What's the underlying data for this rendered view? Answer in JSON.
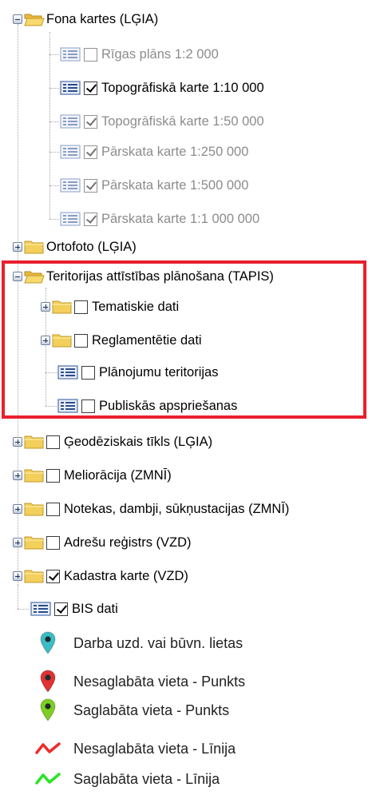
{
  "tree": {
    "fona": {
      "label": "Fona kartes (LĢIA)",
      "children": [
        {
          "label": "Rīgas plāns 1:2 000",
          "checked": false,
          "dimmed": true
        },
        {
          "label": "Topogrāfiskā karte 1:10 000",
          "checked": true,
          "dimmed": false
        },
        {
          "label": "Topogrāfiskā karte 1:50 000",
          "checked": true,
          "dimmed": true
        },
        {
          "label": "Pārskata karte 1:250 000",
          "checked": true,
          "dimmed": true
        },
        {
          "label": "Pārskata karte 1:500 000",
          "checked": true,
          "dimmed": true
        },
        {
          "label": "Pārskata karte 1:1 000 000",
          "checked": true,
          "dimmed": true
        }
      ]
    },
    "ortofoto": {
      "label": "Ortofoto (LĢIA)"
    },
    "tapis": {
      "label": "Teritorijas attīstības plānošana (TAPIS)",
      "children": [
        {
          "label": "Tematiskie dati",
          "type": "folder",
          "checked": false
        },
        {
          "label": "Reglamentētie dati",
          "type": "folder",
          "checked": false
        },
        {
          "label": "Plānojumu teritorijas",
          "type": "layer",
          "checked": false
        },
        {
          "label": "Publiskās apspriešanas",
          "type": "layer",
          "checked": false
        }
      ]
    },
    "groups": [
      {
        "label": "Ģeodēziskais tīkls (LĢIA)",
        "checked": false
      },
      {
        "label": "Meliorācija (ZMNĪ)",
        "checked": false
      },
      {
        "label": "Notekas, dambji, sūkņustacijas (ZMNĪ)",
        "checked": false
      },
      {
        "label": "Adrešu reģistrs (VZD)",
        "checked": false
      },
      {
        "label": "Kadastra karte (VZD)",
        "checked": true
      }
    ],
    "bis": {
      "label": "BIS dati",
      "checked": true
    }
  },
  "legend": [
    {
      "label": "Darba uzd. vai būvn. lietas",
      "icon": "teal-map-pin-icon",
      "color": "#3bbdc7"
    },
    {
      "label": "Nesaglabāta vieta - Punkts",
      "icon": "red-map-pin-icon",
      "color": "#e03232"
    },
    {
      "label": "Saglabāta vieta - Punkts",
      "icon": "green-map-pin-icon",
      "color": "#7ccf21"
    },
    {
      "label": "Nesaglabāta vieta - Līnija",
      "icon": "red-line-icon",
      "color": "#ef2b2b"
    },
    {
      "label": "Saglabāta vieta - Līnija",
      "icon": "green-line-icon",
      "color": "#27e527"
    }
  ],
  "colors": {
    "highlight": "#e8202e",
    "folder": "#f3cf5b",
    "dimmed_text": "#8c8c8c"
  }
}
